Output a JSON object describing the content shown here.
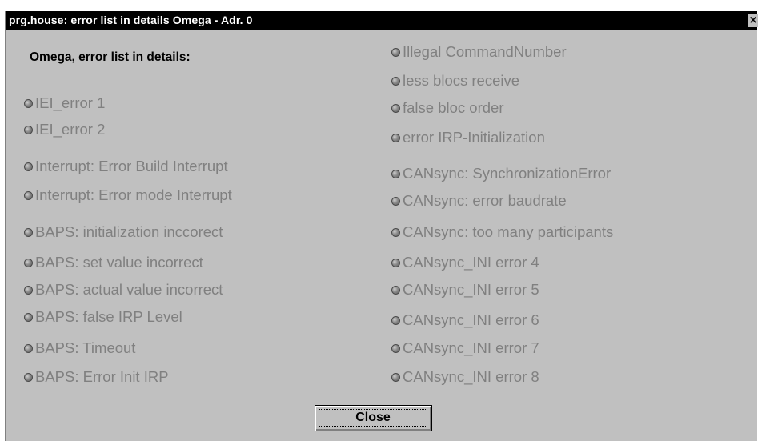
{
  "window": {
    "title": "prg.house: error list in details Omega - Adr. 0",
    "close_glyph": "×"
  },
  "heading": "Omega, error list in details:",
  "left_items": [
    {
      "label": "IEI_error 1",
      "icon": "status-led-icon"
    },
    {
      "label": "IEI_error 2",
      "icon": "status-led-icon"
    },
    {
      "label": "Interrupt: Error Build Interrupt",
      "icon": "status-led-icon"
    },
    {
      "label": "Interrupt: Error mode Interrupt",
      "icon": "status-led-icon"
    },
    {
      "label": "BAPS: initialization inccorect",
      "icon": "status-led-icon"
    },
    {
      "label": "BAPS: set value incorrect",
      "icon": "status-led-icon"
    },
    {
      "label": "BAPS: actual value incorrect",
      "icon": "status-led-icon"
    },
    {
      "label": "BAPS: false IRP Level",
      "icon": "status-led-icon"
    },
    {
      "label": "BAPS: Timeout",
      "icon": "status-led-icon"
    },
    {
      "label": "BAPS: Error Init IRP",
      "icon": "status-led-icon"
    }
  ],
  "right_items": [
    {
      "label": "Illegal CommandNumber",
      "icon": "status-led-icon"
    },
    {
      "label": "less blocs receive",
      "icon": "status-led-icon"
    },
    {
      "label": "false bloc order",
      "icon": "status-led-icon"
    },
    {
      "label": "error IRP-Initialization",
      "icon": "status-led-icon"
    },
    {
      "label": "CANsync: SynchronizationError",
      "icon": "status-led-icon"
    },
    {
      "label": "CANsync: error  baudrate",
      "icon": "status-led-icon"
    },
    {
      "label": "CANsync: too many participants",
      "icon": "status-led-icon"
    },
    {
      "label": "CANsync_INI error 4",
      "icon": "status-led-icon"
    },
    {
      "label": "CANsync_INI error 5",
      "icon": "status-led-icon"
    },
    {
      "label": "CANsync_INI error 6",
      "icon": "status-led-icon"
    },
    {
      "label": "CANsync_INI error 7",
      "icon": "status-led-icon"
    },
    {
      "label": "CANsync_INI error 8",
      "icon": "status-led-icon"
    }
  ],
  "buttons": {
    "close_label": "Close"
  },
  "colors": {
    "window_bg": "#c0c0c0",
    "titlebar_bg": "#000000",
    "inactive_text": "#808080",
    "led_inactive": "#8a8a8a"
  }
}
